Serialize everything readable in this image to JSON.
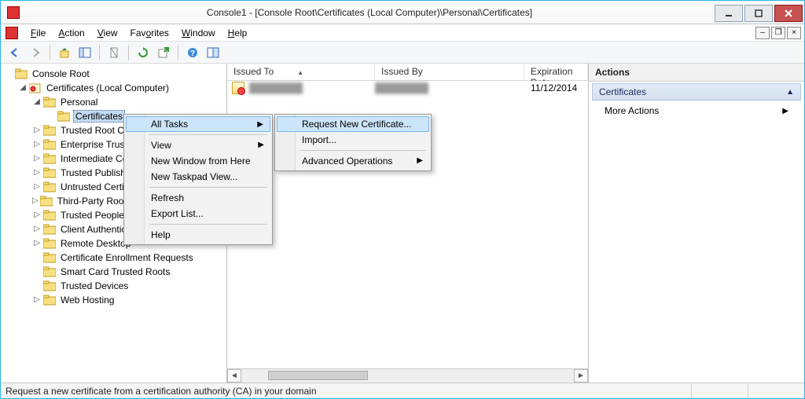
{
  "window": {
    "title": "Console1 - [Console Root\\Certificates (Local Computer)\\Personal\\Certificates]"
  },
  "menubar": {
    "file": "File",
    "action": "Action",
    "view": "View",
    "favorites": "Favorites",
    "window": "Window",
    "help": "Help"
  },
  "tree": {
    "root": "Console Root",
    "cert_root": "Certificates (Local Computer)",
    "personal": "Personal",
    "certificates": "Certificates",
    "items": [
      "Trusted Root Certification Authorities",
      "Enterprise Trust",
      "Intermediate Certification Authorities",
      "Trusted Publishers",
      "Untrusted Certificates",
      "Third-Party Root Certification Authorities",
      "Trusted People",
      "Client Authentication Issuers",
      "Remote Desktop",
      "Certificate Enrollment Requests",
      "Smart Card Trusted Roots",
      "Trusted Devices",
      "Web Hosting"
    ]
  },
  "list": {
    "columns": {
      "issued_to": "Issued To",
      "issued_by": "Issued By",
      "expiration": "Expiration Date"
    },
    "rows": [
      {
        "issued_to": "████████",
        "issued_by": "████████",
        "expiration": "11/12/2014"
      }
    ]
  },
  "actions": {
    "header": "Actions",
    "category": "Certificates",
    "more": "More Actions"
  },
  "context_menu": {
    "all_tasks": "All Tasks",
    "view": "View",
    "new_window": "New Window from Here",
    "new_taskpad": "New Taskpad View...",
    "refresh": "Refresh",
    "export_list": "Export List...",
    "help": "Help"
  },
  "submenu": {
    "request_new": "Request New Certificate...",
    "import": "Import...",
    "advanced": "Advanced Operations"
  },
  "status": {
    "text": "Request a new certificate from a certification authority (CA) in your domain"
  }
}
